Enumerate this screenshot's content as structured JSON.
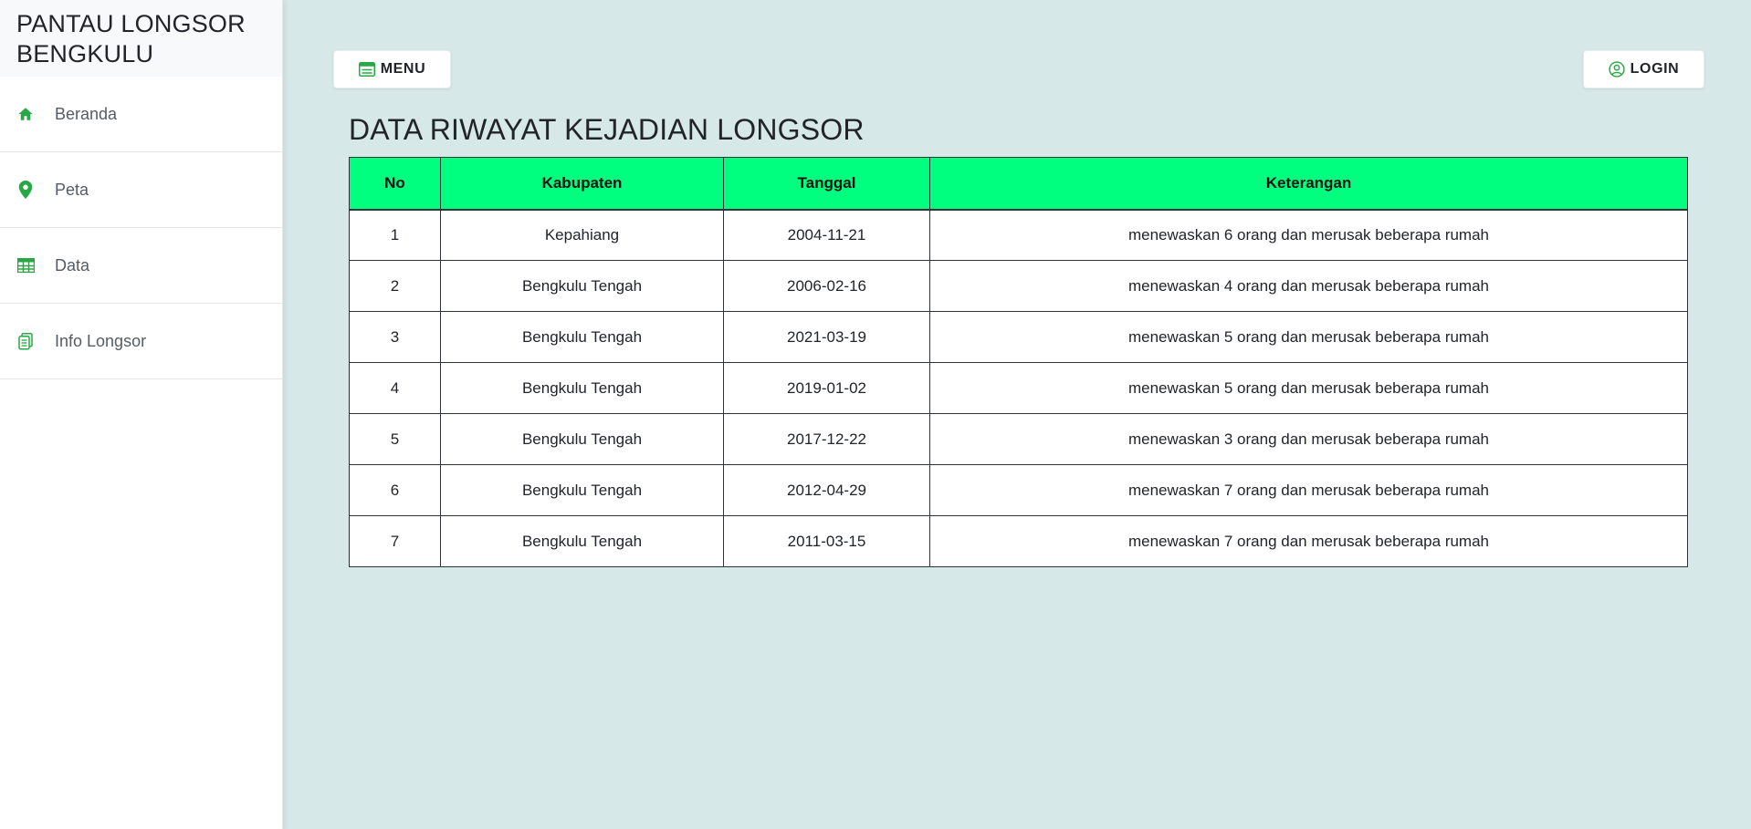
{
  "sidebar": {
    "brand": "PANTAU LONGSOR BENGKULU",
    "items": [
      {
        "label": "Beranda",
        "icon": "home-icon"
      },
      {
        "label": "Peta",
        "icon": "map-pin-icon"
      },
      {
        "label": "Data",
        "icon": "table-icon"
      },
      {
        "label": "Info Longsor",
        "icon": "document-icon"
      }
    ]
  },
  "header": {
    "menu_label": "MENU",
    "login_label": "LOGIN"
  },
  "main": {
    "title": "DATA RIWAYAT KEJADIAN LONGSOR",
    "table": {
      "headers": [
        "No",
        "Kabupaten",
        "Tanggal",
        "Keterangan"
      ],
      "rows": [
        [
          "1",
          "Kepahiang",
          "2004-11-21",
          "menewaskan 6 orang dan merusak beberapa rumah"
        ],
        [
          "2",
          "Bengkulu Tengah",
          "2006-02-16",
          "menewaskan 4 orang dan merusak beberapa rumah"
        ],
        [
          "3",
          "Bengkulu Tengah",
          "2021-03-19",
          "menewaskan 5 orang dan merusak beberapa rumah"
        ],
        [
          "4",
          "Bengkulu Tengah",
          "2019-01-02",
          "menewaskan 5 orang dan merusak beberapa rumah"
        ],
        [
          "5",
          "Bengkulu Tengah",
          "2017-12-22",
          "menewaskan 3 orang dan merusak beberapa rumah"
        ],
        [
          "6",
          "Bengkulu Tengah",
          "2012-04-29",
          "menewaskan 7 orang dan merusak beberapa rumah"
        ],
        [
          "7",
          "Bengkulu Tengah",
          "2011-03-15",
          "menewaskan 7 orang dan merusak beberapa rumah"
        ]
      ]
    }
  },
  "colors": {
    "accent": "#28a745",
    "table_header": "#00ff7f",
    "background": "#d7e8e8"
  }
}
